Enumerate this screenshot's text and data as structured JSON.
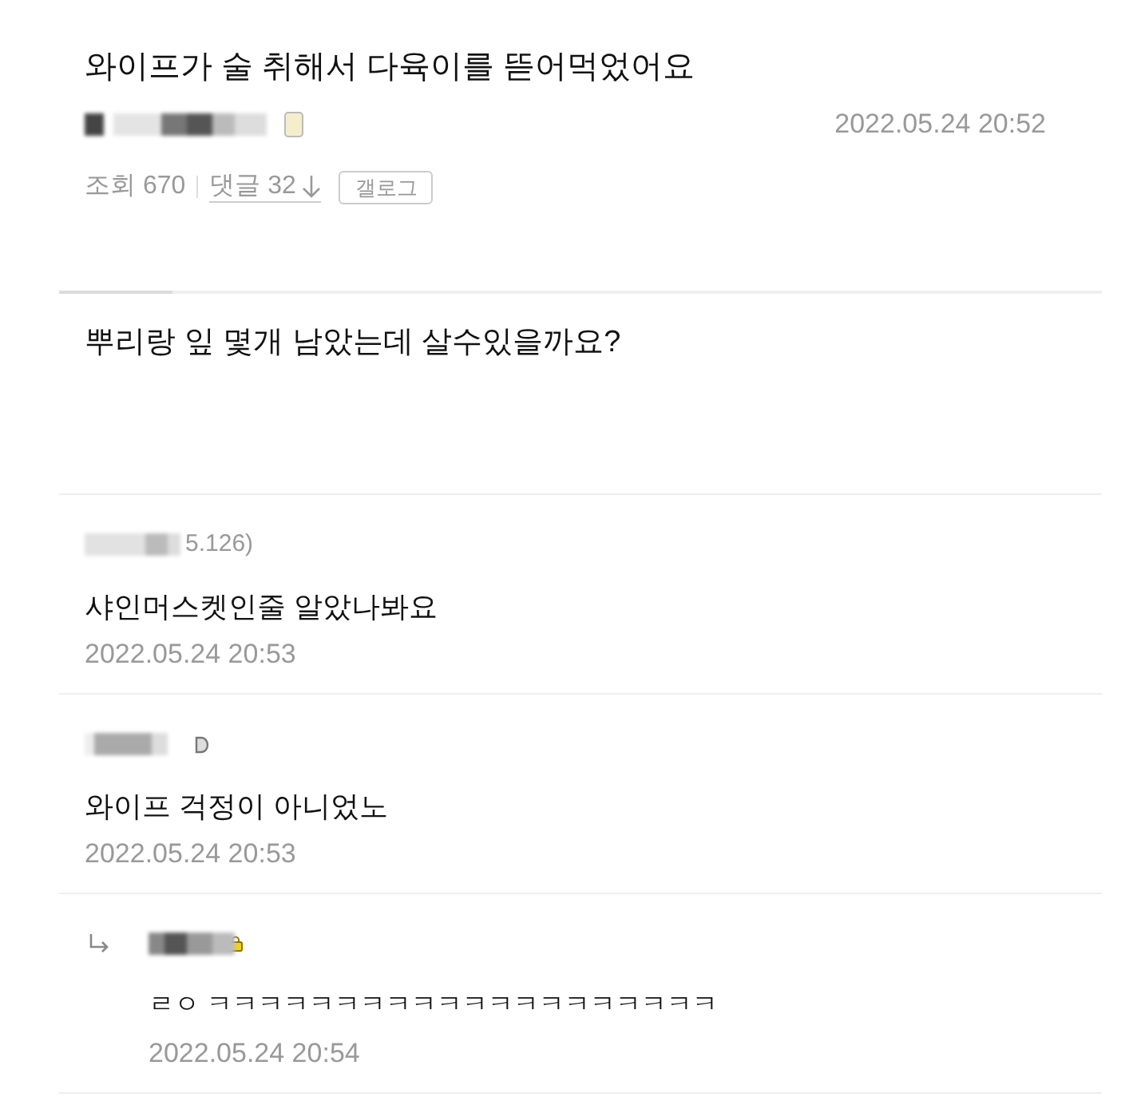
{
  "post": {
    "title": "와이프가 술 취해서 다육이를 뜯어먹었어요",
    "author": {
      "blurred": true,
      "badge": {
        "kind": "square"
      }
    },
    "date": "2022.05.24 20:52",
    "views": "조회 670",
    "comments_link": "댓글 32",
    "gallog_button": "갤로그",
    "body": "뿌리랑 잎 몇개 남았는데 살수있을까요?"
  },
  "comments": [
    {
      "kind": "comment",
      "author": {
        "blurred": true,
        "text": "5.126)"
      },
      "text": "샤인머스켓인줄 알았나봐요",
      "date": "2022.05.24 20:53"
    },
    {
      "kind": "comment",
      "author": {
        "blurred": true,
        "badge": {
          "kind": "half"
        }
      },
      "text": "와이프 걱정이 아니었노",
      "date": "2022.05.24 20:53"
    },
    {
      "kind": "reply",
      "author": {
        "blurred": true,
        "badge": {
          "kind": "lock"
        }
      },
      "text": "ㄹㅇ ㅋㅋㅋㅋㅋㅋㅋㅋㅋㅋㅋㅋㅋㅋㅋㅋㅋㅋㅋㅋ",
      "date": "2022.05.24 20:54"
    }
  ]
}
